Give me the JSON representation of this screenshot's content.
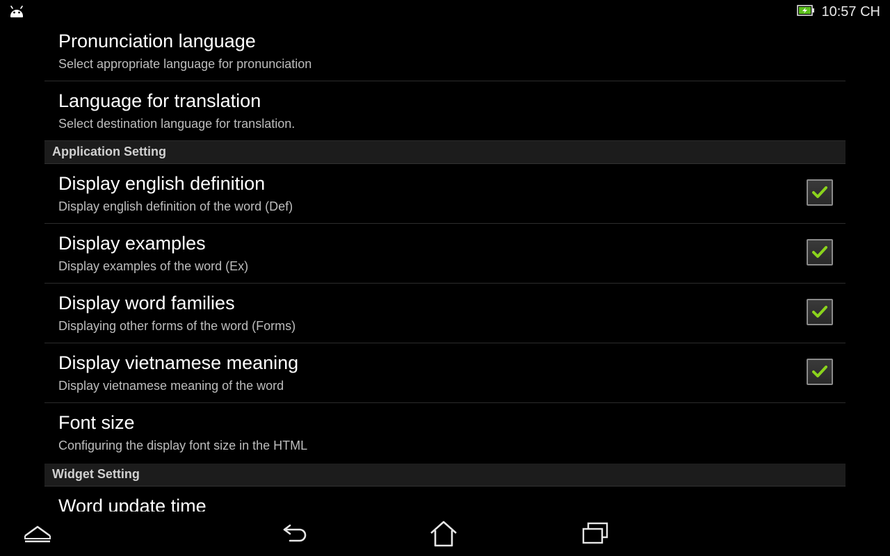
{
  "status_bar": {
    "app_icon": "android-robot-icon",
    "battery_icon": "battery-charging-icon",
    "time": "10:57 CH"
  },
  "settings": {
    "pronunciation": {
      "title": "Pronunciation language",
      "summary": "Select appropriate language for pronunciation"
    },
    "translation": {
      "title": "Language for translation",
      "summary": "Select destination language for translation."
    },
    "application_section": "Application Setting",
    "english_definition": {
      "title": "Display english definition",
      "summary": "Display english definition of the word (Def)",
      "checked": true
    },
    "examples": {
      "title": "Display examples",
      "summary": "Display examples of the word (Ex)",
      "checked": true
    },
    "word_families": {
      "title": "Display word families",
      "summary": "Displaying other forms of the word (Forms)",
      "checked": true
    },
    "vietnamese_meaning": {
      "title": "Display vietnamese meaning",
      "summary": "Display vietnamese meaning of the word",
      "checked": true
    },
    "font_size": {
      "title": "Font size",
      "summary": "Configuring the display font size in the HTML"
    },
    "widget_section": "Widget Setting",
    "word_update_time": {
      "title": "Word update time"
    }
  },
  "nav_bar": {
    "icons": [
      "menu-up-icon",
      "back-icon",
      "home-icon",
      "recent-apps-icon"
    ]
  },
  "colors": {
    "check": "#8bd31d",
    "background": "#000000",
    "section_header": "#1c1c1c"
  }
}
